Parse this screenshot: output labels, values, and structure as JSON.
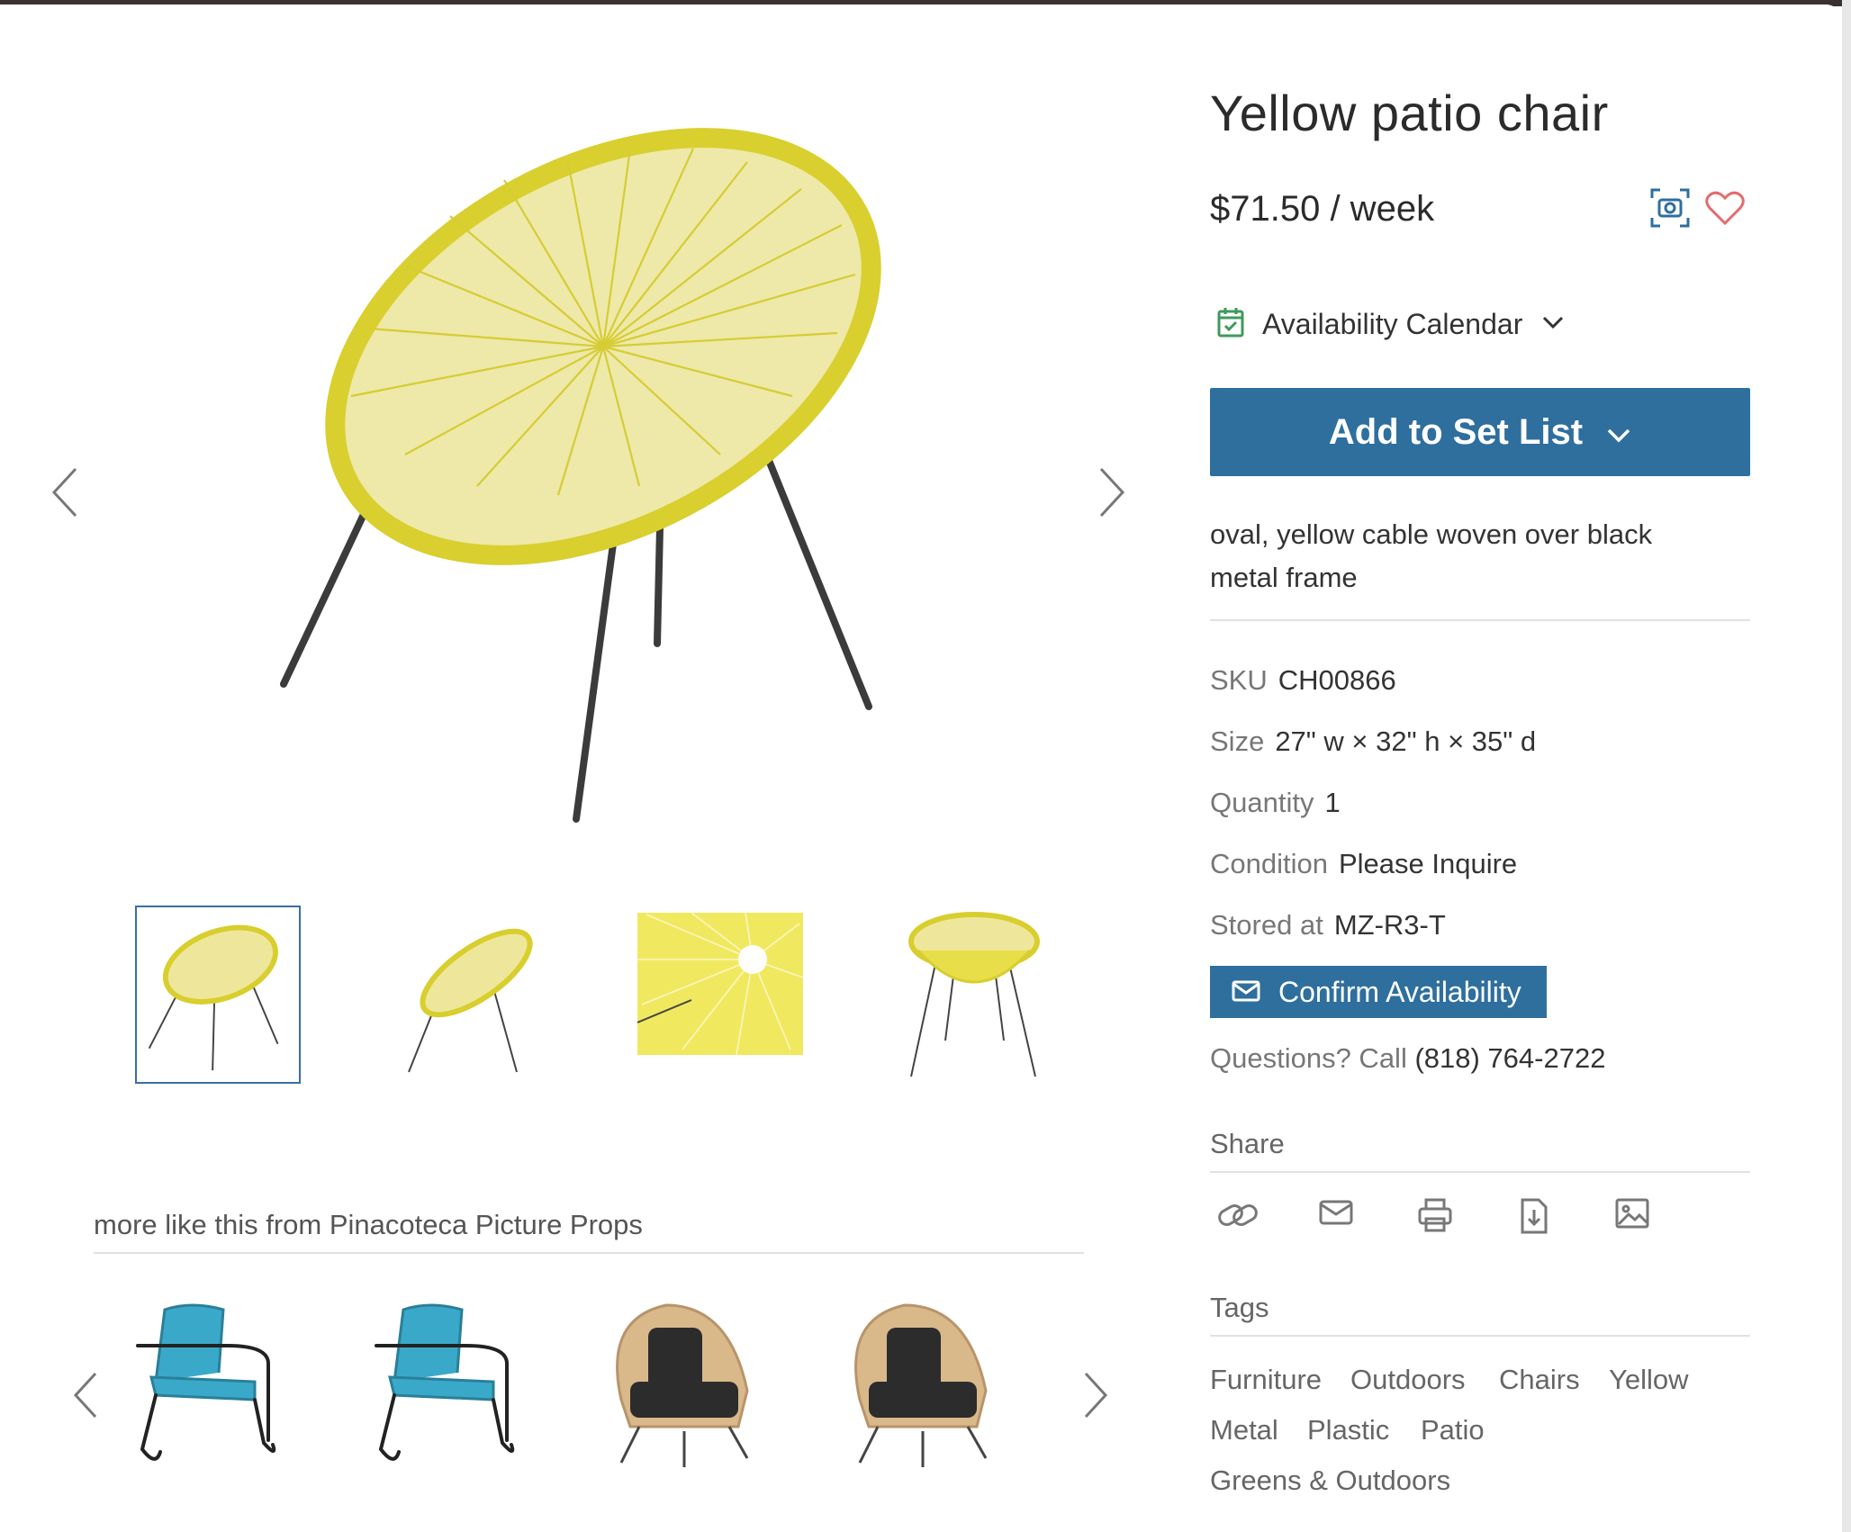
{
  "product": {
    "title": "Yellow patio chair",
    "price": "$71.50 / week",
    "description": "oval, yellow cable woven over black metal frame"
  },
  "availability": {
    "label": "Availability Calendar"
  },
  "add_button": {
    "label": "Add to Set List"
  },
  "specs": [
    {
      "key": "SKU",
      "value": "CH00866"
    },
    {
      "key": "Size",
      "value": "27\" w × 32\" h × 35\" d"
    },
    {
      "key": "Quantity",
      "value": "1"
    },
    {
      "key": "Condition",
      "value": "Please Inquire"
    },
    {
      "key": "Stored at",
      "value": "MZ-R3-T"
    }
  ],
  "confirm": {
    "label": "Confirm Availability"
  },
  "questions": {
    "prefix": "Questions? Call ",
    "phone": "(818) 764-2722"
  },
  "share": {
    "label": "Share",
    "icons": [
      "link-icon",
      "email-icon",
      "print-icon",
      "download-icon",
      "image-icon"
    ]
  },
  "tags": {
    "label": "Tags",
    "items": [
      "Furniture",
      "Outdoors",
      "Chairs",
      "Yellow",
      "Metal",
      "Plastic",
      "Patio",
      "Greens & Outdoors"
    ]
  },
  "more": {
    "title": "more like this from Pinacoteca Picture Props"
  },
  "colors": {
    "accent": "#2e6f9e",
    "chair_yellow": "#e3d83a",
    "heart": "#e46b6b",
    "calendar": "#3f9a5c",
    "teal": "#3aa9c9"
  }
}
